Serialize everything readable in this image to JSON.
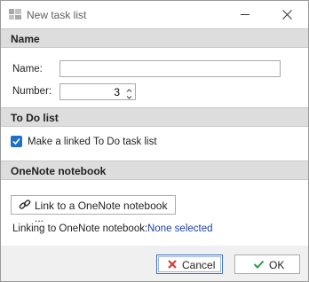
{
  "window": {
    "title": "New task list"
  },
  "sections": {
    "name": {
      "header": "Name"
    },
    "todo": {
      "header": "To Do list"
    },
    "onenote": {
      "header": "OneNote notebook"
    }
  },
  "fields": {
    "name_label": "Name:",
    "name_value": "",
    "number_label": "Number:",
    "number_value": "3"
  },
  "todo": {
    "checkbox_label": "Make a linked To Do task list",
    "checked": true
  },
  "onenote": {
    "link_button_label": "Link to a OneNote notebook ...",
    "linking_label": "Linking to OneNote notebook:",
    "linking_value": "None selected"
  },
  "buttons": {
    "cancel_label": "Cancel",
    "ok_label": "OK"
  },
  "icons": {
    "app": "app-icon",
    "minimize": "minimize-icon",
    "close": "close-icon",
    "spin_up": "chevron-up-icon",
    "spin_down": "chevron-down-icon",
    "check": "checkmark-icon",
    "link": "chain-link-icon",
    "cancel": "red-x-icon",
    "ok": "green-check-icon"
  },
  "colors": {
    "checkbox": "#1f6fc5",
    "link_value": "#1a3fa8",
    "cancel_x": "#d83b2e",
    "ok_check": "#2f9a48"
  }
}
